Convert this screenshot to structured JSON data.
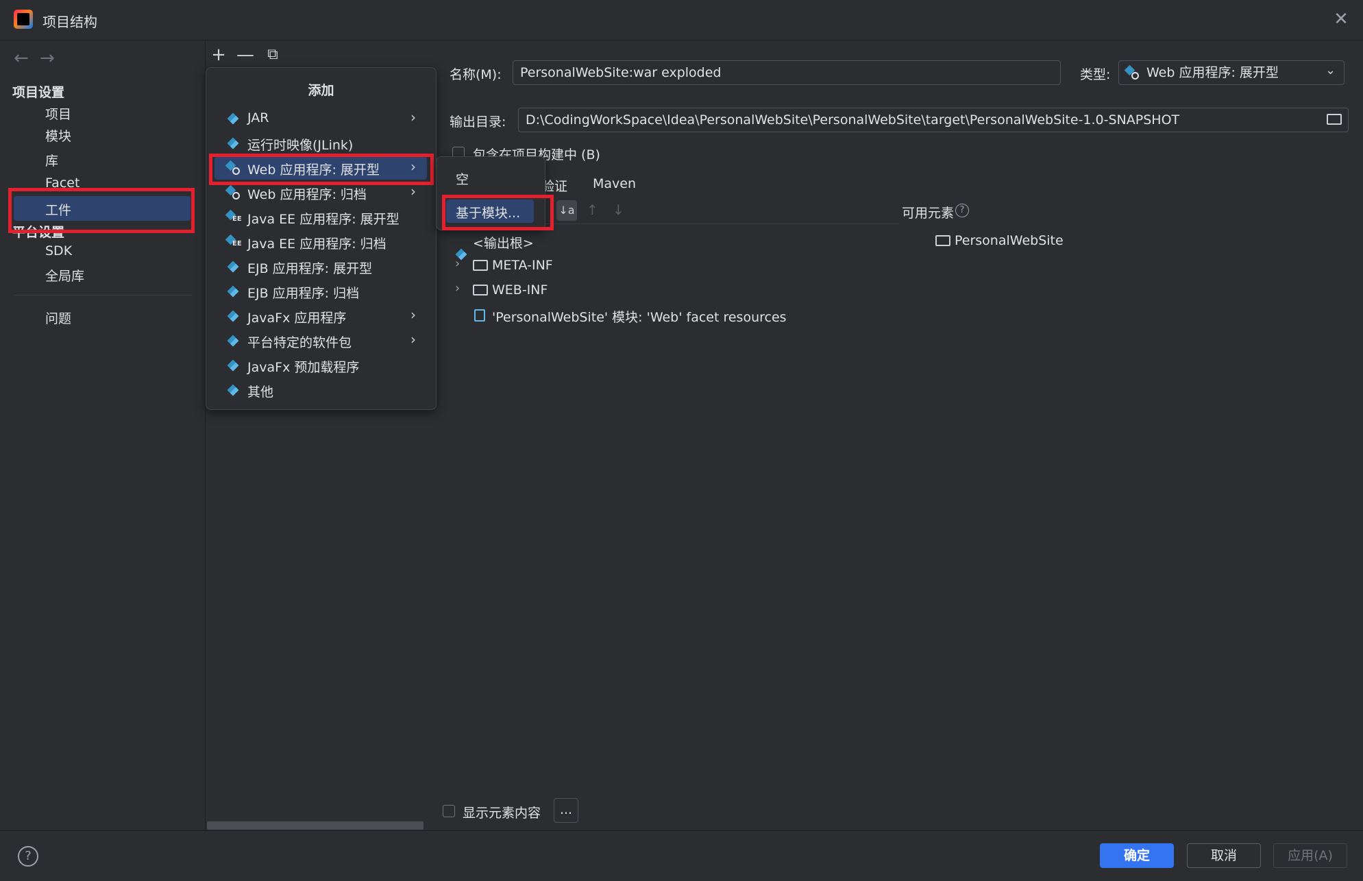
{
  "window": {
    "title": "项目结构",
    "close": "✕"
  },
  "sidebar": {
    "back": "←",
    "forward": "→",
    "project_settings_header": "项目设置",
    "project_items": [
      "项目",
      "模块",
      "库",
      "Facet",
      "工件"
    ],
    "platform_settings_header": "平台设置",
    "platform_items": [
      "SDK",
      "全局库"
    ],
    "problems": "问题"
  },
  "list_toolbar": {
    "add": "+",
    "remove": "—",
    "copy": "⧉"
  },
  "add_menu": {
    "title": "添加",
    "items": [
      {
        "label": "JAR",
        "icon": "artifact-icon",
        "submenu": true
      },
      {
        "label": "运行时映像(JLink)",
        "icon": "artifact-icon",
        "submenu": false
      },
      {
        "label": "Web 应用程序: 展开型",
        "icon": "web-artifact-icon",
        "submenu": true,
        "selected": true
      },
      {
        "label": "Web 应用程序: 归档",
        "icon": "web-artifact-icon",
        "submenu": true
      },
      {
        "label": "Java EE 应用程序: 展开型",
        "icon": "javaee-icon",
        "submenu": false
      },
      {
        "label": "Java EE 应用程序: 归档",
        "icon": "javaee-icon",
        "submenu": false
      },
      {
        "label": "EJB 应用程序: 展开型",
        "icon": "ejb-icon",
        "submenu": false
      },
      {
        "label": "EJB 应用程序: 归档",
        "icon": "ejb-icon",
        "submenu": false
      },
      {
        "label": "JavaFx 应用程序",
        "icon": "artifact-icon",
        "submenu": true
      },
      {
        "label": "平台特定的软件包",
        "icon": "artifact-icon",
        "submenu": true
      },
      {
        "label": "JavaFx 预加载程序",
        "icon": "artifact-icon",
        "submenu": false
      },
      {
        "label": "其他",
        "icon": "artifact-icon",
        "submenu": false
      }
    ],
    "chevron": "›"
  },
  "sub_menu": {
    "empty": "空",
    "from_module": "基于模块..."
  },
  "form": {
    "name_label": "名称(M):",
    "name_value": "PersonalWebSite:war exploded",
    "type_label": "类型:",
    "type_value": "Web 应用程序: 展开型",
    "output_label": "输出目录:",
    "output_value": "D:\\CodingWorkSpace\\Idea\\PersonalWebSite\\PersonalWebSite\\target\\PersonalWebSite-1.0-SNAPSHOT",
    "include_build": "包含在项目构建中 (B)"
  },
  "tabs": [
    "验证",
    "Maven"
  ],
  "layout_toolbar": {
    "sort": "↓a",
    "up": "↑",
    "down": "↓"
  },
  "available": {
    "label": "可用元素",
    "help": "?",
    "item": "PersonalWebSite"
  },
  "tree": {
    "output_root": "<输出根>",
    "meta_inf": "META-INF",
    "web_inf": "WEB-INF",
    "facet_resources": "'PersonalWebSite' 模块: 'Web' facet resources"
  },
  "bottom": {
    "show_content": "显示元素内容",
    "more": "..."
  },
  "footer": {
    "help": "?",
    "ok": "确定",
    "cancel": "取消",
    "apply": "应用(A)"
  },
  "colors": {
    "accent": "#3574f0",
    "selection": "#2e436e",
    "highlight_box": "#e5202e",
    "background": "#2b2d30"
  }
}
